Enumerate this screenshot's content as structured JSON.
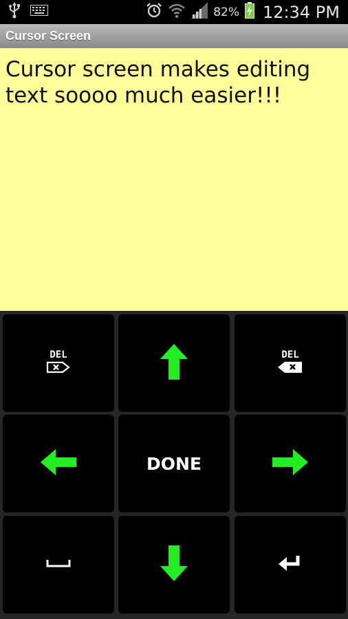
{
  "status_bar": {
    "battery_percent": "82%",
    "time": "12:34 PM",
    "icons": [
      "usb-icon",
      "keyboard-icon",
      "alarm-icon",
      "wifi-icon",
      "signal-icon",
      "battery-charging-icon"
    ]
  },
  "title_bar": {
    "title": "Cursor Screen"
  },
  "editor": {
    "text": "Cursor screen makes editing text soooo much easier!!!"
  },
  "keypad": {
    "delete_forward_label": "DEL",
    "backspace_label": "DEL",
    "done_label": "DONE",
    "arrow_color": "#22ee22",
    "icons": [
      "delete-forward-icon",
      "arrow-up-icon",
      "backspace-icon",
      "arrow-left-icon",
      "arrow-right-icon",
      "space-icon",
      "arrow-down-icon",
      "enter-icon"
    ]
  },
  "colors": {
    "editor_background": "#ffff99",
    "key_background": "#000000",
    "arrow": "#22ee22"
  }
}
